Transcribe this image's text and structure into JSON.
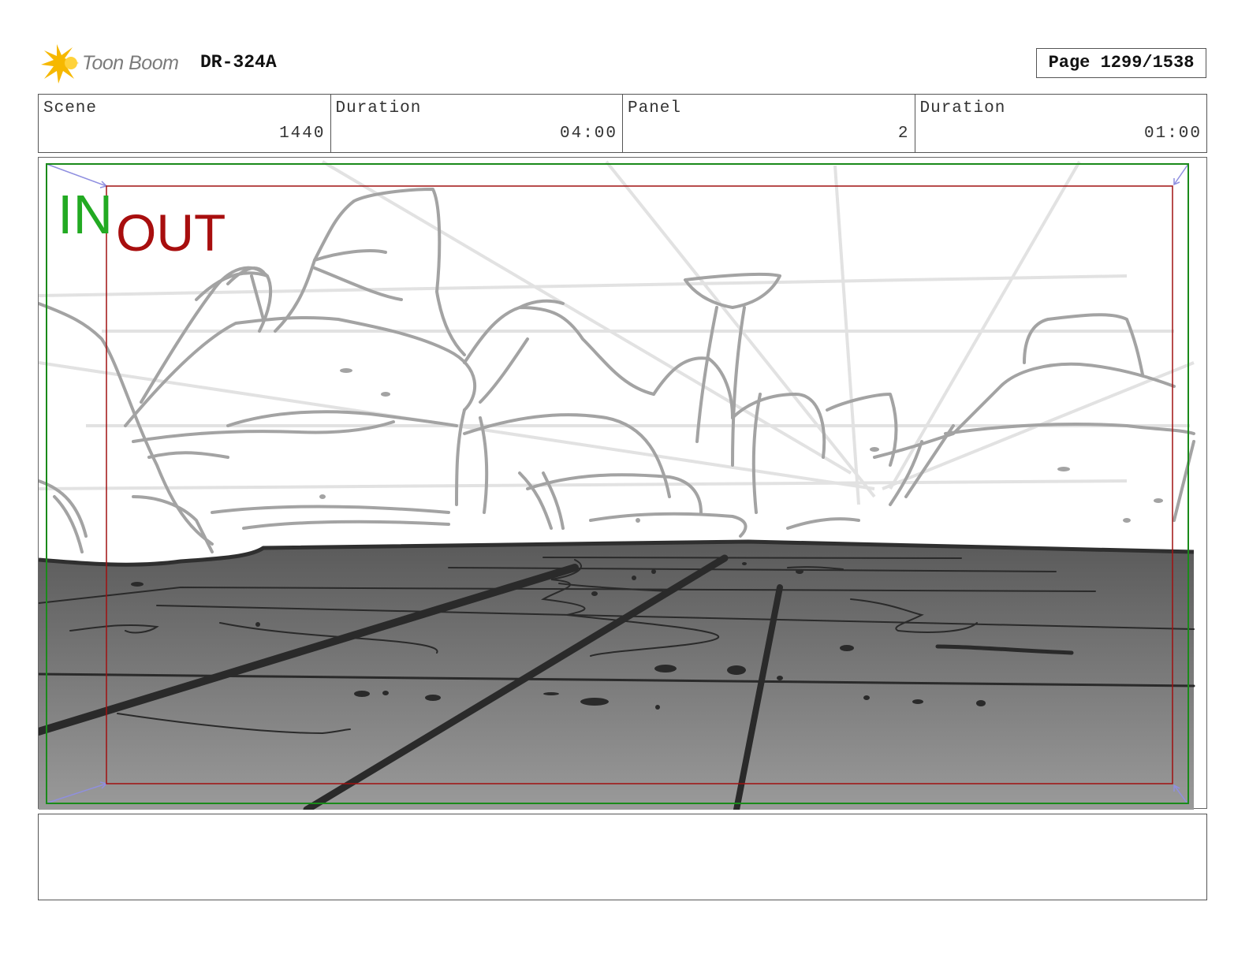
{
  "header": {
    "logo_text": "Toon Boom",
    "doc_id": "DR-324A",
    "page_label": "Page 1299/1538"
  },
  "info": [
    {
      "label": "Scene",
      "value": "1440"
    },
    {
      "label": "Duration",
      "value": "04:00"
    },
    {
      "label": "Panel",
      "value": "2"
    },
    {
      "label": "Duration",
      "value": "01:00"
    }
  ],
  "panel": {
    "in_label": "IN",
    "out_label": "OUT",
    "colors": {
      "in_frame": "#1a8a1a",
      "out_frame": "#a01010",
      "in_text": "#22aa22",
      "out_text": "#a80e0e",
      "ground_top": "#5a5a5a",
      "ground_bottom": "#9a9a9a",
      "sketch_line": "#9d9d9d"
    }
  },
  "notes": {
    "text": ""
  }
}
